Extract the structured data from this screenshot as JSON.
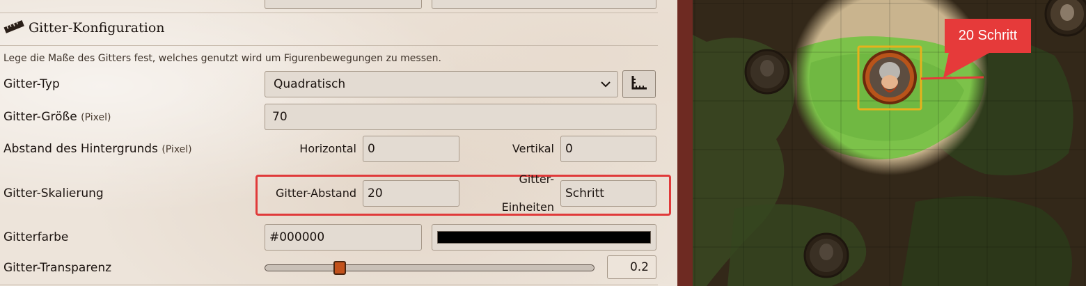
{
  "header": {
    "title": "Gitter-Konfiguration"
  },
  "description": "Lege die Maße des Gitters fest, welches genutzt wird um Figurenbewegungen zu messen.",
  "grid_type": {
    "label": "Gitter-Typ",
    "value": "Quadratisch",
    "icon": "ruler-corner-icon"
  },
  "grid_size": {
    "label": "Gitter-Größe",
    "unit": "(Pixel)",
    "value": "70"
  },
  "background_offset": {
    "label": "Abstand des Hintergrunds",
    "unit": "(Pixel)",
    "horizontal_label": "Horizontal",
    "horizontal_value": "0",
    "vertical_label": "Vertikal",
    "vertical_value": "0"
  },
  "grid_scale": {
    "label": "Gitter-Skalierung",
    "distance_label": "Gitter-Abstand",
    "distance_value": "20",
    "units_label_line1": "Gitter-",
    "units_label_line2": "Einheiten",
    "units_value": "Schritt",
    "highlight_color": "#e03a3a"
  },
  "grid_color": {
    "label": "Gitterfarbe",
    "value": "#000000",
    "swatch": "#000000"
  },
  "grid_alpha": {
    "label": "Gitter-Transparenz",
    "value": "0.2",
    "slider_fraction": 0.2,
    "thumb_color": "#c2521c"
  },
  "map": {
    "tooltip": "20 Schritt",
    "tooltip_color": "#e63a3a"
  }
}
